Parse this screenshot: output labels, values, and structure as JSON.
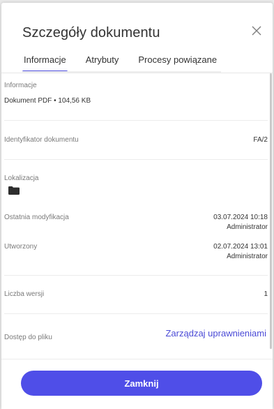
{
  "dialog": {
    "title": "Szczegóły dokumentu",
    "close_icon": "close-icon",
    "tabs": [
      {
        "label": "Informacje",
        "active": true
      },
      {
        "label": "Atrybuty",
        "active": false
      },
      {
        "label": "Procesy powiązane",
        "active": false
      }
    ]
  },
  "info": {
    "section_label": "Informacje",
    "file_summary": "Dokument PDF • 104,56 KB",
    "id_label": "Identyfikator dokumentu",
    "id_value": "FA/2",
    "location_label": "Lokalizacja",
    "location_icon": "folder-icon",
    "modified_label": "Ostatnia modyfikacja",
    "modified_date": "03.07.2024 10:18",
    "modified_by": "Administrator",
    "created_label": "Utworzony",
    "created_date": "02.07.2024 13:01",
    "created_by": "Administrator",
    "versions_label": "Liczba wersji",
    "versions_value": "1",
    "access_label": "Dostęp do pliku",
    "access_link": "Zarządzaj uprawnieniami"
  },
  "footer": {
    "close_button": "Zamknij"
  },
  "colors": {
    "accent": "#4f4ee8",
    "link": "#4a4ad6",
    "muted_text": "#7a7a7a"
  }
}
